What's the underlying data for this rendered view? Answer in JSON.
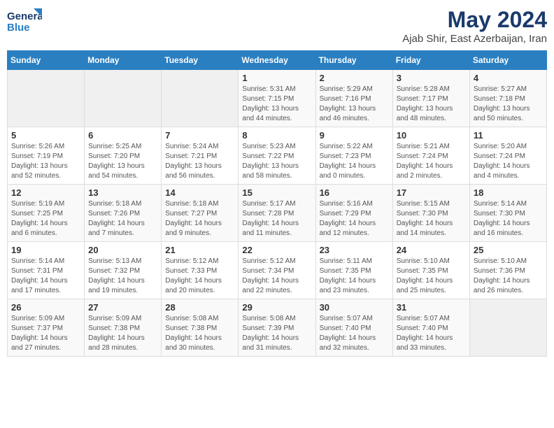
{
  "logo": {
    "general": "General",
    "blue": "Blue"
  },
  "title": {
    "month_year": "May 2024",
    "location": "Ajab Shir, East Azerbaijan, Iran"
  },
  "headers": [
    "Sunday",
    "Monday",
    "Tuesday",
    "Wednesday",
    "Thursday",
    "Friday",
    "Saturday"
  ],
  "weeks": [
    {
      "days": [
        {
          "number": "",
          "info": ""
        },
        {
          "number": "",
          "info": ""
        },
        {
          "number": "",
          "info": ""
        },
        {
          "number": "1",
          "info": "Sunrise: 5:31 AM\nSunset: 7:15 PM\nDaylight: 13 hours\nand 44 minutes."
        },
        {
          "number": "2",
          "info": "Sunrise: 5:29 AM\nSunset: 7:16 PM\nDaylight: 13 hours\nand 46 minutes."
        },
        {
          "number": "3",
          "info": "Sunrise: 5:28 AM\nSunset: 7:17 PM\nDaylight: 13 hours\nand 48 minutes."
        },
        {
          "number": "4",
          "info": "Sunrise: 5:27 AM\nSunset: 7:18 PM\nDaylight: 13 hours\nand 50 minutes."
        }
      ]
    },
    {
      "days": [
        {
          "number": "5",
          "info": "Sunrise: 5:26 AM\nSunset: 7:19 PM\nDaylight: 13 hours\nand 52 minutes."
        },
        {
          "number": "6",
          "info": "Sunrise: 5:25 AM\nSunset: 7:20 PM\nDaylight: 13 hours\nand 54 minutes."
        },
        {
          "number": "7",
          "info": "Sunrise: 5:24 AM\nSunset: 7:21 PM\nDaylight: 13 hours\nand 56 minutes."
        },
        {
          "number": "8",
          "info": "Sunrise: 5:23 AM\nSunset: 7:22 PM\nDaylight: 13 hours\nand 58 minutes."
        },
        {
          "number": "9",
          "info": "Sunrise: 5:22 AM\nSunset: 7:23 PM\nDaylight: 14 hours\nand 0 minutes."
        },
        {
          "number": "10",
          "info": "Sunrise: 5:21 AM\nSunset: 7:24 PM\nDaylight: 14 hours\nand 2 minutes."
        },
        {
          "number": "11",
          "info": "Sunrise: 5:20 AM\nSunset: 7:24 PM\nDaylight: 14 hours\nand 4 minutes."
        }
      ]
    },
    {
      "days": [
        {
          "number": "12",
          "info": "Sunrise: 5:19 AM\nSunset: 7:25 PM\nDaylight: 14 hours\nand 6 minutes."
        },
        {
          "number": "13",
          "info": "Sunrise: 5:18 AM\nSunset: 7:26 PM\nDaylight: 14 hours\nand 7 minutes."
        },
        {
          "number": "14",
          "info": "Sunrise: 5:18 AM\nSunset: 7:27 PM\nDaylight: 14 hours\nand 9 minutes."
        },
        {
          "number": "15",
          "info": "Sunrise: 5:17 AM\nSunset: 7:28 PM\nDaylight: 14 hours\nand 11 minutes."
        },
        {
          "number": "16",
          "info": "Sunrise: 5:16 AM\nSunset: 7:29 PM\nDaylight: 14 hours\nand 12 minutes."
        },
        {
          "number": "17",
          "info": "Sunrise: 5:15 AM\nSunset: 7:30 PM\nDaylight: 14 hours\nand 14 minutes."
        },
        {
          "number": "18",
          "info": "Sunrise: 5:14 AM\nSunset: 7:30 PM\nDaylight: 14 hours\nand 16 minutes."
        }
      ]
    },
    {
      "days": [
        {
          "number": "19",
          "info": "Sunrise: 5:14 AM\nSunset: 7:31 PM\nDaylight: 14 hours\nand 17 minutes."
        },
        {
          "number": "20",
          "info": "Sunrise: 5:13 AM\nSunset: 7:32 PM\nDaylight: 14 hours\nand 19 minutes."
        },
        {
          "number": "21",
          "info": "Sunrise: 5:12 AM\nSunset: 7:33 PM\nDaylight: 14 hours\nand 20 minutes."
        },
        {
          "number": "22",
          "info": "Sunrise: 5:12 AM\nSunset: 7:34 PM\nDaylight: 14 hours\nand 22 minutes."
        },
        {
          "number": "23",
          "info": "Sunrise: 5:11 AM\nSunset: 7:35 PM\nDaylight: 14 hours\nand 23 minutes."
        },
        {
          "number": "24",
          "info": "Sunrise: 5:10 AM\nSunset: 7:35 PM\nDaylight: 14 hours\nand 25 minutes."
        },
        {
          "number": "25",
          "info": "Sunrise: 5:10 AM\nSunset: 7:36 PM\nDaylight: 14 hours\nand 26 minutes."
        }
      ]
    },
    {
      "days": [
        {
          "number": "26",
          "info": "Sunrise: 5:09 AM\nSunset: 7:37 PM\nDaylight: 14 hours\nand 27 minutes."
        },
        {
          "number": "27",
          "info": "Sunrise: 5:09 AM\nSunset: 7:38 PM\nDaylight: 14 hours\nand 28 minutes."
        },
        {
          "number": "28",
          "info": "Sunrise: 5:08 AM\nSunset: 7:38 PM\nDaylight: 14 hours\nand 30 minutes."
        },
        {
          "number": "29",
          "info": "Sunrise: 5:08 AM\nSunset: 7:39 PM\nDaylight: 14 hours\nand 31 minutes."
        },
        {
          "number": "30",
          "info": "Sunrise: 5:07 AM\nSunset: 7:40 PM\nDaylight: 14 hours\nand 32 minutes."
        },
        {
          "number": "31",
          "info": "Sunrise: 5:07 AM\nSunset: 7:40 PM\nDaylight: 14 hours\nand 33 minutes."
        },
        {
          "number": "",
          "info": ""
        }
      ]
    }
  ]
}
